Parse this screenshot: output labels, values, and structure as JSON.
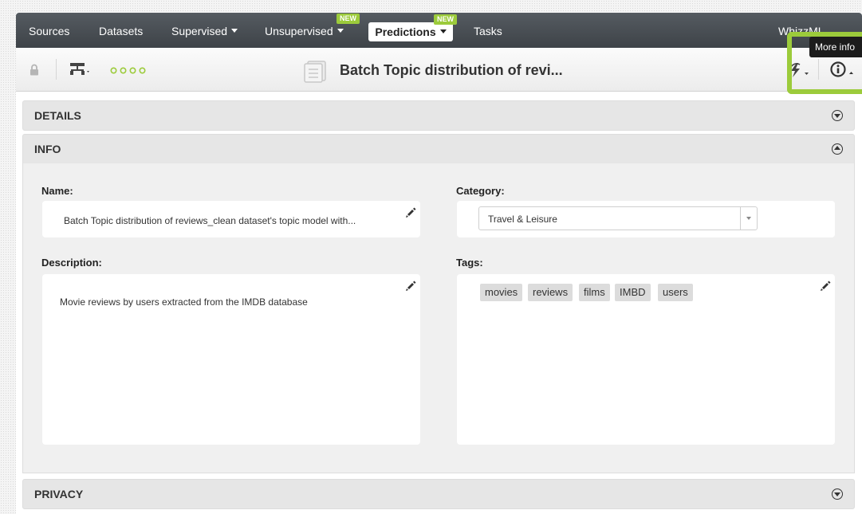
{
  "nav": {
    "items": [
      {
        "label": "Sources"
      },
      {
        "label": "Datasets"
      },
      {
        "label": "Supervised"
      },
      {
        "label": "Unsupervised"
      },
      {
        "label": "Predictions"
      },
      {
        "label": "Tasks"
      }
    ],
    "new_badge": "NEW",
    "right_text": "WhizzML"
  },
  "toolbar": {
    "title": "Batch Topic distribution of revi..."
  },
  "sections": {
    "details": "DETAILS",
    "info": "INFO",
    "privacy": "PRIVACY"
  },
  "info": {
    "name_label": "Name:",
    "name_value": "Batch Topic distribution of reviews_clean dataset's topic model with...",
    "category_label": "Category:",
    "category_value": "Travel & Leisure",
    "description_label": "Description:",
    "description_value": "Movie reviews by users extracted from the IMDB database",
    "tags_label": "Tags:",
    "tags": [
      "movies",
      "reviews",
      "films",
      "IMBD",
      "users"
    ]
  },
  "tooltip": "More info",
  "colors": {
    "accent": "#9ccb3b",
    "nav_bg": "#474c51"
  }
}
